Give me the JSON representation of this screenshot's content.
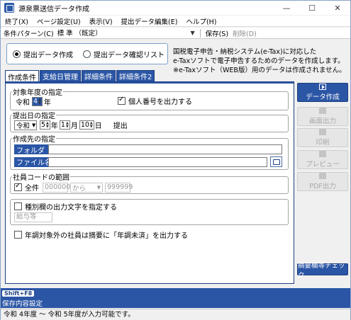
{
  "window": {
    "title": "源泉票送信データ作成",
    "minimize": "—",
    "maximize": "☐",
    "close": "✕"
  },
  "menu": [
    "終了(X)",
    "ページ設定(U)",
    "表示(V)",
    "提出データ編集(E)",
    "ヘルプ(H)"
  ],
  "pattern": {
    "label": "条件パターン(C)",
    "value": "標 準 （既定）",
    "save": "保存(S)",
    "delete": "削除(D)"
  },
  "mode": {
    "option1": "提出データ作成",
    "option2": "提出データ確認リスト",
    "selected": "option1"
  },
  "notice": [
    "国税電子申告・納税システム(e-Tax)に対応した",
    "e-Taxソフトで電子申告するためのデータを作成します。",
    "※e-Taxソフト（WEB版）用のデータは作成されません。"
  ],
  "tabs": [
    "作成条件",
    "支給日管理",
    "詳細条件",
    "詳細条件2"
  ],
  "target_year": {
    "legend": "対象年度の指定",
    "era": "令和",
    "year": "4",
    "year_unit": "年",
    "mynumber_label": "個人番号を出力する",
    "mynumber_checked": true
  },
  "submit_date": {
    "legend": "提出日の指定",
    "era": "令和",
    "year": "5",
    "year_unit": "年",
    "month": "1",
    "month_unit": "月",
    "day": "10",
    "day_unit": "日",
    "suffix": "提出"
  },
  "destination": {
    "legend": "作成先の指定",
    "folder_label": "フォルダ",
    "folder_value": "",
    "file_label": "ファイル名",
    "file_value": ""
  },
  "employee_range": {
    "legend": "社員コードの範囲",
    "all_label": "全件",
    "all_checked": true,
    "from": "000000",
    "from_unit": "から",
    "to": "999999"
  },
  "category_output": {
    "label": "種別欄の出力文字を指定する",
    "checked": false,
    "placeholder": "給与等"
  },
  "year_end_label": "年調対象外の社員は摘要に「年調未済」を出力する",
  "side_buttons": {
    "create": "データ作成",
    "screen_output": "画面出力",
    "print": "印刷",
    "preview": "プレビュー",
    "pdf": "PDF出力",
    "check": "摘要欄等チェック"
  },
  "fkey": {
    "key": "Shift+F8",
    "label": "保存内容設定"
  },
  "status": "令和 4年度 ～ 令和 5年度が入力可能です。"
}
